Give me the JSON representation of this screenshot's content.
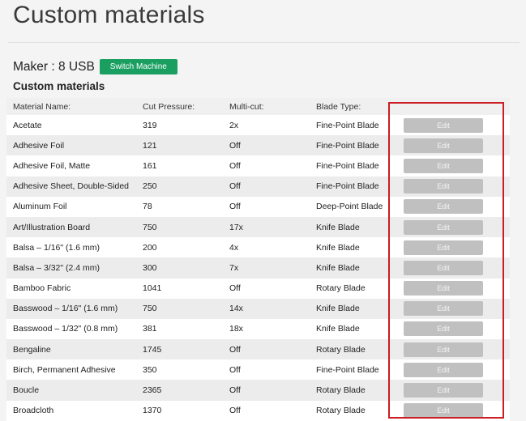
{
  "page": {
    "title": "Custom materials"
  },
  "maker": {
    "label": "Maker : 8 USB",
    "switch_label": "Switch Machine"
  },
  "section_title": "Custom materials",
  "columns": [
    "Material Name:",
    "Cut Pressure:",
    "Multi-cut:",
    "Blade Type:"
  ],
  "edit_label": "Edit",
  "colors": {
    "switch_button": "#1a9f61",
    "highlight_box": "#cc1c24",
    "edit_button": "#c0c0c0"
  },
  "rows": [
    {
      "name": "Acetate",
      "pressure": "319",
      "multicut": "2x",
      "blade": "Fine-Point Blade"
    },
    {
      "name": "Adhesive Foil",
      "pressure": "121",
      "multicut": "Off",
      "blade": "Fine-Point Blade"
    },
    {
      "name": "Adhesive Foil, Matte",
      "pressure": "161",
      "multicut": "Off",
      "blade": "Fine-Point Blade"
    },
    {
      "name": "Adhesive Sheet, Double-Sided",
      "pressure": "250",
      "multicut": "Off",
      "blade": "Fine-Point Blade"
    },
    {
      "name": "Aluminum Foil",
      "pressure": "78",
      "multicut": "Off",
      "blade": "Deep-Point Blade"
    },
    {
      "name": "Art/Illustration Board",
      "pressure": "750",
      "multicut": "17x",
      "blade": "Knife Blade"
    },
    {
      "name": "Balsa – 1/16\" (1.6 mm)",
      "pressure": "200",
      "multicut": "4x",
      "blade": "Knife Blade"
    },
    {
      "name": "Balsa – 3/32\" (2.4 mm)",
      "pressure": "300",
      "multicut": "7x",
      "blade": "Knife Blade"
    },
    {
      "name": "Bamboo Fabric",
      "pressure": "1041",
      "multicut": "Off",
      "blade": "Rotary Blade"
    },
    {
      "name": "Basswood – 1/16\" (1.6 mm)",
      "pressure": "750",
      "multicut": "14x",
      "blade": "Knife Blade"
    },
    {
      "name": "Basswood – 1/32\" (0.8 mm)",
      "pressure": "381",
      "multicut": "18x",
      "blade": "Knife Blade"
    },
    {
      "name": "Bengaline",
      "pressure": "1745",
      "multicut": "Off",
      "blade": "Rotary Blade"
    },
    {
      "name": "Birch, Permanent Adhesive",
      "pressure": "350",
      "multicut": "Off",
      "blade": "Fine-Point Blade"
    },
    {
      "name": "Boucle",
      "pressure": "2365",
      "multicut": "Off",
      "blade": "Rotary Blade"
    },
    {
      "name": "Broadcloth",
      "pressure": "1370",
      "multicut": "Off",
      "blade": "Rotary Blade"
    }
  ]
}
